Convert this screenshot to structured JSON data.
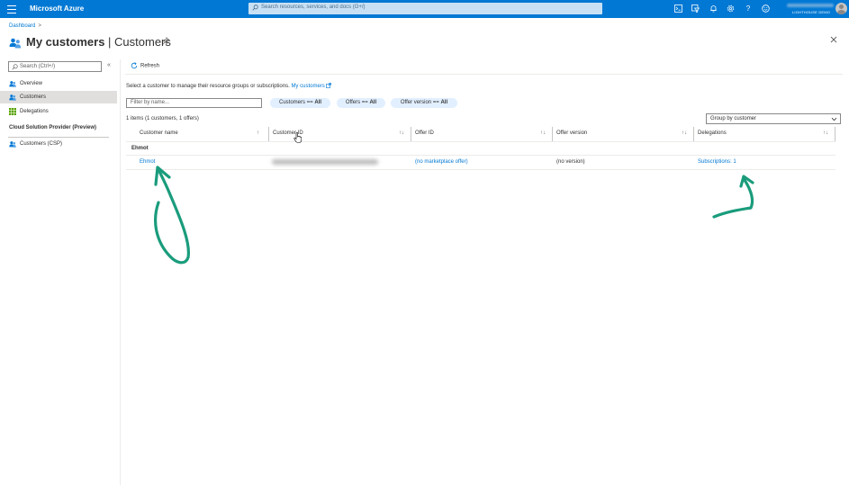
{
  "topbar": {
    "brand": "Microsoft Azure",
    "search_placeholder": "Search resources, services, and docs (G+/)",
    "tenant": "LIGHTHOUSE DEMO",
    "icons": [
      "cloud-shell-icon",
      "directory-filter-icon",
      "notifications-icon",
      "settings-icon",
      "help-icon",
      "feedback-icon"
    ]
  },
  "breadcrumb": {
    "root": "Dashboard",
    "separator": ">"
  },
  "page": {
    "title_main": "My customers",
    "title_separator": " | ",
    "title_sub": "Customers"
  },
  "nav": {
    "search_placeholder": "Search (Ctrl+/)",
    "collapse": "«",
    "items": [
      {
        "label": "Overview",
        "icon": "overview-icon"
      },
      {
        "label": "Customers",
        "icon": "customers-icon",
        "active": true
      },
      {
        "label": "Delegations",
        "icon": "delegations-icon"
      }
    ],
    "section_title": "Cloud Solution Provider (Preview)",
    "section_items": [
      {
        "label": "Customers (CSP)",
        "icon": "customers-csp-icon"
      }
    ]
  },
  "toolbar": {
    "refresh": "Refresh"
  },
  "intro": {
    "text": "Select a customer to manage their resource groups or subscriptions.",
    "link": "My customers"
  },
  "filters": {
    "name_placeholder": "Filter by name...",
    "pills": [
      {
        "prefix": "Customers == ",
        "value": "All"
      },
      {
        "prefix": "Offers == ",
        "value": "All"
      },
      {
        "prefix": "Offer version == ",
        "value": "All"
      }
    ]
  },
  "summary": {
    "count": "1 items (1 customers, 1 offers)"
  },
  "groupby": {
    "selected": "Group by customer"
  },
  "table": {
    "columns": [
      "Customer name",
      "Customer ID",
      "Offer ID",
      "Offer version",
      "Delegations"
    ],
    "group": "Ehmot",
    "rows": [
      {
        "customer_name": "Ehmot",
        "offer_id": "(no marketplace offer)",
        "offer_version": "(no version)",
        "delegations": "Subscriptions: 1"
      }
    ]
  },
  "colors": {
    "accent": "#0078d4",
    "annotation": "#1a9c7c"
  }
}
